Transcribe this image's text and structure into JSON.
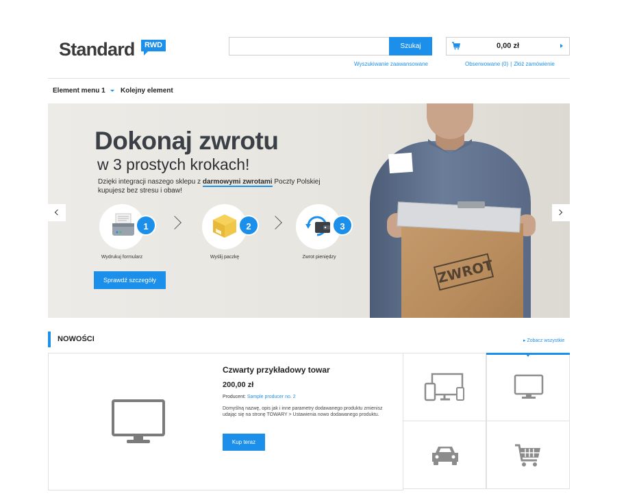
{
  "header": {
    "logo_text": "Standard",
    "logo_badge": "RWD",
    "search": {
      "placeholder": "",
      "button_label": "Szukaj",
      "advanced_link": "Wyszukiwanie zaawansowane"
    },
    "cart": {
      "total": "0,00 zł",
      "observed_link": "Obserwowane (0)",
      "separator": "|",
      "order_link": "Złóż zamówienie"
    }
  },
  "menu": {
    "items": [
      {
        "label": "Element menu 1"
      },
      {
        "label": "Kolejny element"
      }
    ]
  },
  "banner": {
    "title": "Dokonaj zwrotu",
    "subtitle": "w 3 prostych krokach!",
    "desc_before": "Dzięki integracji naszego sklepu z ",
    "desc_highlight": "darmowymi zwrotami",
    "desc_after": " Poczty Polskiej kupujesz bez stresu i obaw!",
    "steps": [
      {
        "number": "1",
        "label": "Wydrukuj formularz"
      },
      {
        "number": "2",
        "label": "Wyślij paczkę"
      },
      {
        "number": "3",
        "label": "Zwrot pieniędzy"
      }
    ],
    "button_label": "Sprawdź szczegóły",
    "stamp_text": "ZWROT"
  },
  "news": {
    "title": "NOWOŚCI",
    "see_all": "▸ Zobacz wszystkie",
    "product": {
      "name": "Czwarty przykładowy towar",
      "price": "200,00 zł",
      "producer_label": "Producent:",
      "producer_name": "Sample producer no. 2",
      "description": "Domyślną nazwę, opis jak i inne parametry dodawanego produktu zmienisz udając się na stronę TOWARY > Ustawienia nowo dodawanego produktu.",
      "buy_label": "Kup teraz"
    },
    "tiles": [
      {
        "icon": "devices-icon",
        "active": false
      },
      {
        "icon": "monitor-icon",
        "active": true
      },
      {
        "icon": "car-icon",
        "active": false
      },
      {
        "icon": "shopping-cart-icon",
        "active": false
      }
    ]
  },
  "colors": {
    "accent": "#1c8fea",
    "text": "#222222",
    "border": "#e0e0e0"
  }
}
